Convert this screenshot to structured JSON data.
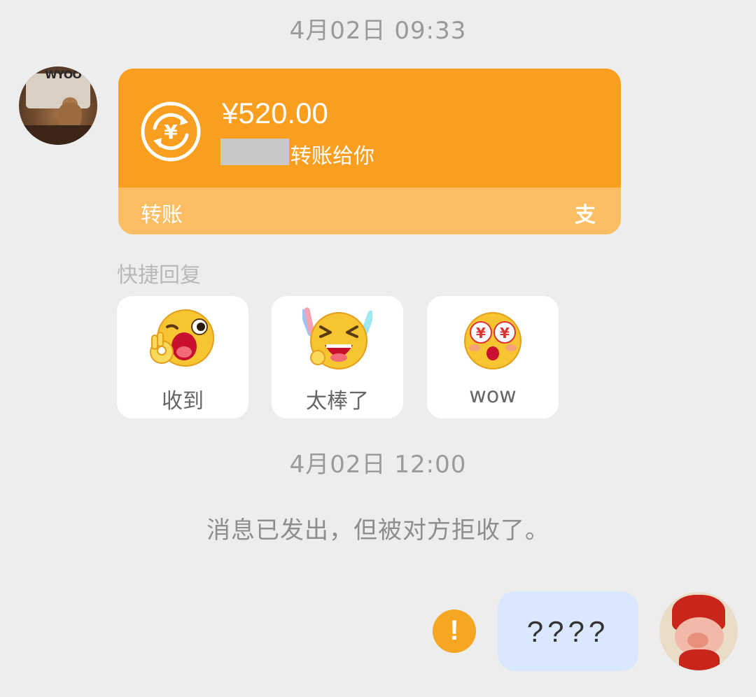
{
  "timestamps": [
    "4月02日 09:33",
    "4月02日 12:00"
  ],
  "transfer": {
    "amount": "¥520.00",
    "description": "转账给你",
    "label": "转账",
    "payment_mark": "支",
    "colors": {
      "card": "#fa9e1f",
      "footer": "#fcbd63"
    }
  },
  "quick_reply": {
    "title": "快捷回复",
    "items": [
      {
        "label": "收到",
        "icon": "ok-hand-wink-emoji"
      },
      {
        "label": "太棒了",
        "icon": "cheering-emoji"
      },
      {
        "label": "wow",
        "icon": "money-eyes-emoji"
      }
    ]
  },
  "system_message": "消息已发出，但被对方拒收了。",
  "outgoing": {
    "text": "????",
    "status": "alert-icon",
    "bubble_color": "#d9e8fe"
  },
  "avatars": {
    "left_logo": "WYOO"
  }
}
